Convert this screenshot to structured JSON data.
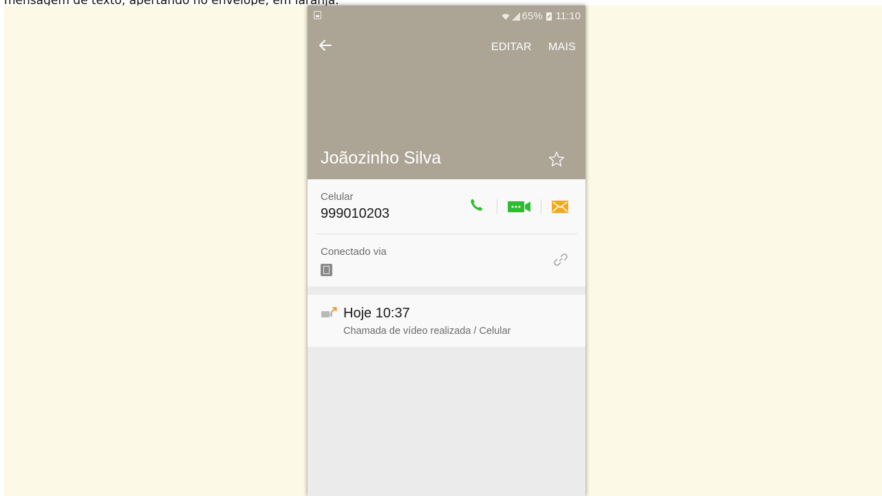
{
  "caption": "mensagem de texto, apertando no envelope, em laranja.",
  "colors": {
    "slide_background": "#fcf9e6",
    "header_background": "#aca596",
    "call_green": "#2ebd2e",
    "message_orange": "#f4a81d",
    "missed_log_orange": "#f08a24"
  },
  "status_bar": {
    "battery": "65%",
    "time": "11:10",
    "icons": [
      "notification-icon",
      "wifi-icon",
      "signal-icon",
      "battery-icon"
    ]
  },
  "header": {
    "back_icon": "arrow-left-icon",
    "edit_label": "EDITAR",
    "more_label": "MAIS",
    "contact_name": "Joãozinho Silva",
    "star_icon": "star-outline-icon"
  },
  "phone_entry": {
    "label": "Celular",
    "number": "999010203",
    "actions": [
      "phone-icon",
      "video-call-icon",
      "envelope-icon"
    ]
  },
  "connection": {
    "label": "Conectado via",
    "device_icon": "tablet-icon",
    "link_icon": "link-icon"
  },
  "call_log": {
    "icon": "outgoing-video-call-icon",
    "time": "Hoje 10:37",
    "detail": "Chamada de vídeo realizada / Celular"
  }
}
